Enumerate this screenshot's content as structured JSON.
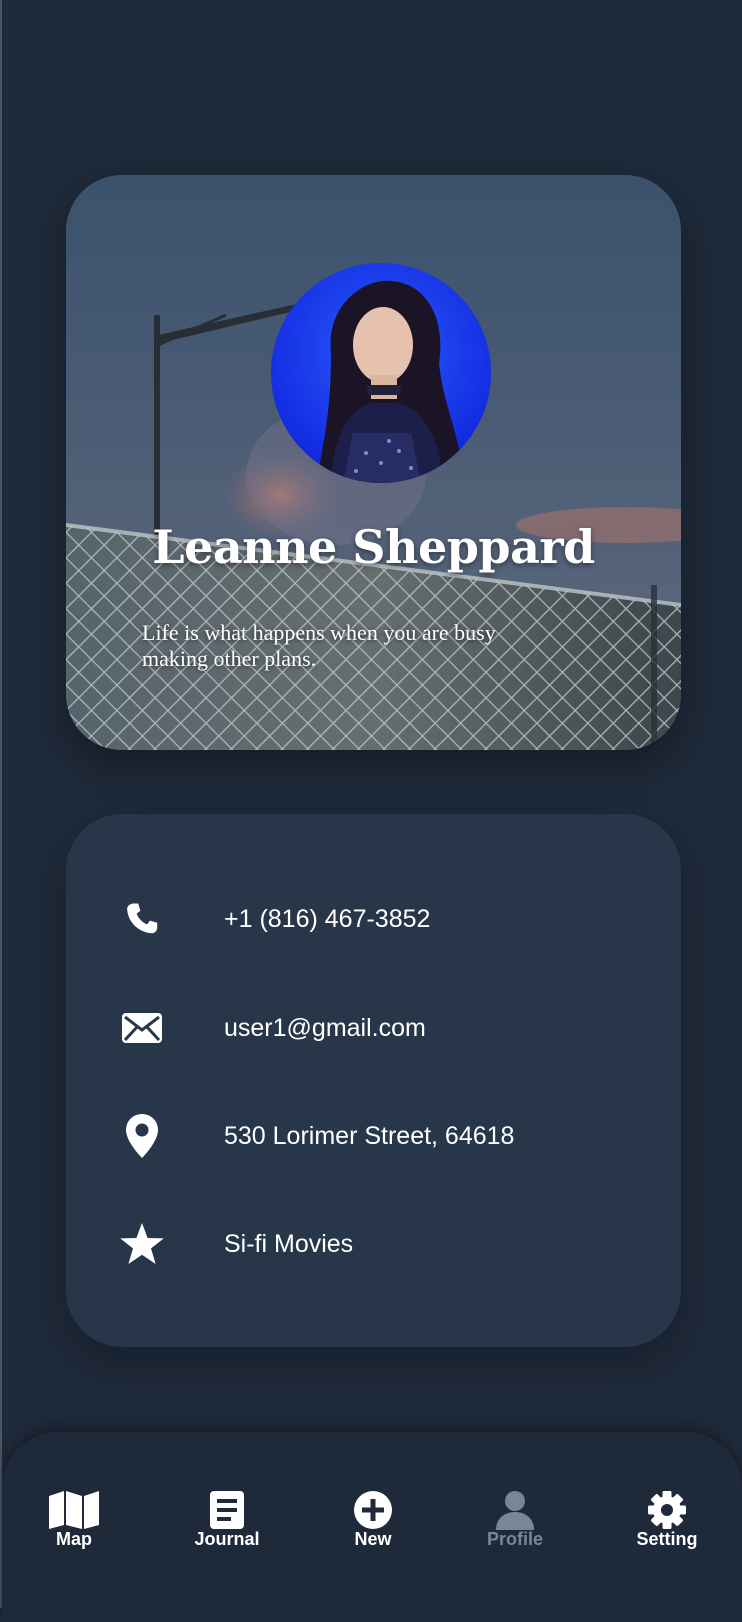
{
  "profile": {
    "name": "Leanne Sheppard",
    "quote": "Life is what happens when you are busy making other plans."
  },
  "info": {
    "items": [
      {
        "icon": "phone-icon",
        "text": "+1 (816) 467-3852"
      },
      {
        "icon": "mail-icon",
        "text": "user1@gmail.com"
      },
      {
        "icon": "location-pin-icon",
        "text": "530 Lorimer Street, 64618"
      },
      {
        "icon": "star-icon",
        "text": "Si-fi Movies"
      }
    ]
  },
  "nav": {
    "items": [
      {
        "label": "Map",
        "icon": "map-icon",
        "active": false
      },
      {
        "label": "Journal",
        "icon": "journal-icon",
        "active": false
      },
      {
        "label": "New",
        "icon": "plus-circle-icon",
        "active": false
      },
      {
        "label": "Profile",
        "icon": "user-icon",
        "active": true
      },
      {
        "label": "Setting",
        "icon": "gear-icon",
        "active": false
      }
    ]
  },
  "colors": {
    "background": "#1f2a3a",
    "card": "#28364a",
    "nav": "#1e2939",
    "active_nav": "#7a8693",
    "avatar_bg": "#1e3cff"
  }
}
